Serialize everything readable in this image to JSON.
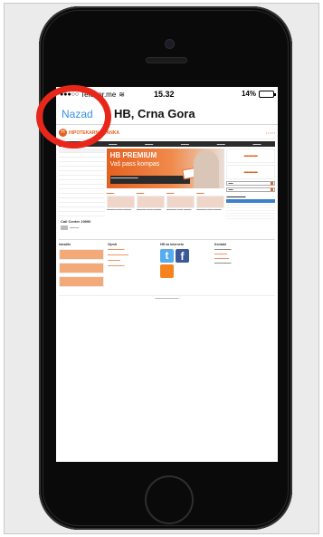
{
  "status_bar": {
    "signal": "●●●○○",
    "carrier": "Telenor.me",
    "time": "15.32",
    "battery_percent": "14%",
    "battery_level": 0.14
  },
  "nav": {
    "back_label": "Nazad",
    "title": "HB, Crna Gora"
  },
  "site": {
    "logo_text": "HIPOTEKARNA BANKA",
    "banner_title": "HB PREMIUM",
    "banner_subtitle": "Vaš pass kompas",
    "lower_headers": [
      "Istražite",
      "Vijesti",
      "HB na Internetu",
      "Kontakt"
    ],
    "call_center": "Call Center 19990"
  },
  "colors": {
    "accent": "#e5611f",
    "ios_blue": "#3b8fe8",
    "highlight_circle": "#e8271b"
  }
}
